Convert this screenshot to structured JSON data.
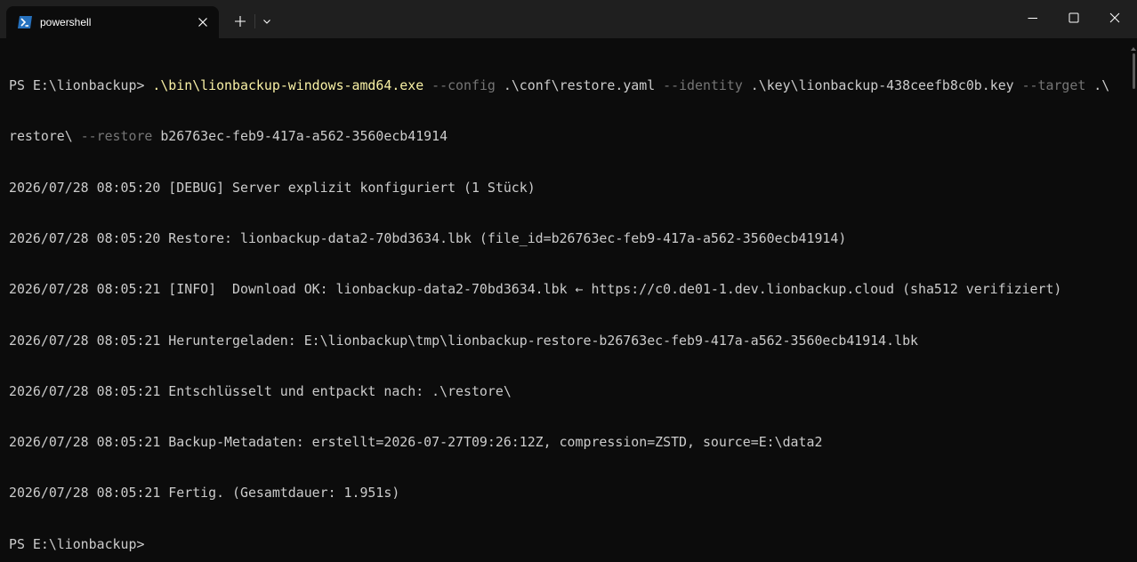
{
  "window": {
    "tab_title": "powershell",
    "icons": {
      "tab": "powershell-icon",
      "tab_close": "close-icon",
      "new_tab": "plus-icon",
      "dropdown": "chevron-down-icon",
      "minimize": "minimize-icon",
      "maximize": "maximize-icon",
      "close": "close-icon"
    }
  },
  "terminal": {
    "command": {
      "prompt": "PS E:\\lionbackup> ",
      "exe_part1": ".\\bin\\lionbackup-windows-amd64.exe",
      "sp1": " ",
      "flag_config": "--config",
      "config_val": " .\\conf\\restore.yaml ",
      "flag_identity": "--identity",
      "identity_val": " .\\key\\lionbackup-438ceefb8c0b.key ",
      "flag_target": "--target",
      "target_val1": " .\\",
      "target_val2": "restore\\ ",
      "flag_restore": "--restore",
      "restore_val": " b26763ec-feb9-417a-a562-3560ecb41914"
    },
    "output": [
      "2026/07/28 08:05:20 [DEBUG] Server explizit konfiguriert (1 Stück)",
      "2026/07/28 08:05:20 Restore: lionbackup-data2-70bd3634.lbk (file_id=b26763ec-feb9-417a-a562-3560ecb41914)",
      "2026/07/28 08:05:21 [INFO]  Download OK: lionbackup-data2-70bd3634.lbk ← https://c0.de01-1.dev.lionbackup.cloud (sha512 verifiziert)",
      "2026/07/28 08:05:21 Heruntergeladen: E:\\lionbackup\\tmp\\lionbackup-restore-b26763ec-feb9-417a-a562-3560ecb41914.lbk",
      "2026/07/28 08:05:21 Entschlüsselt und entpackt nach: .\\restore\\",
      "2026/07/28 08:05:21 Backup-Metadaten: erstellt=2026-07-27T09:26:12Z, compression=ZSTD, source=E:\\data2",
      "2026/07/28 08:05:21 Fertig. (Gesamtdauer: 1.951s)"
    ],
    "final_prompt": "PS E:\\lionbackup>"
  },
  "colors": {
    "background": "#0c0c0c",
    "titlebar": "#1f1f1f",
    "text": "#cccccc",
    "command": "#f9f1a5",
    "parameter": "#767676"
  }
}
